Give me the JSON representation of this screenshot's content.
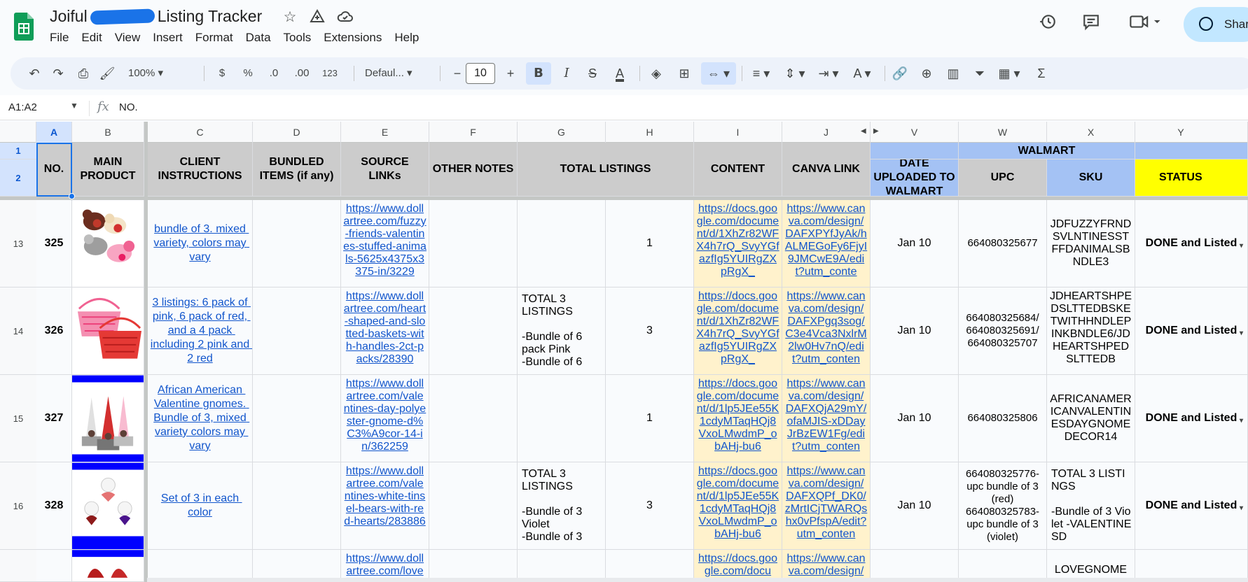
{
  "title": {
    "before": "Joiful",
    "after": "Listing Tracker"
  },
  "menu": [
    "File",
    "Edit",
    "View",
    "Insert",
    "Format",
    "Data",
    "Tools",
    "Extensions",
    "Help"
  ],
  "share_label": "Shar",
  "toolbar": {
    "zoom": "100%",
    "currency": "$",
    "percent": "%",
    "dec_minus": ".0",
    "dec_plus": ".00",
    "format_123": "123",
    "font": "Defaul...",
    "font_size": "10"
  },
  "formula_bar": {
    "name_box": "A1:A2",
    "value": "NO."
  },
  "columns": [
    "A",
    "B",
    "C",
    "D",
    "E",
    "F",
    "G",
    "H",
    "I",
    "J",
    "V",
    "W",
    "X",
    "Y"
  ],
  "row_numbers": [
    "1",
    "2",
    "13",
    "14",
    "15",
    "16"
  ],
  "headers": {
    "no": "NO.",
    "main_product": "MAIN PRODUCT",
    "client_instructions": "CLIENT INSTRUCTIONS",
    "bundled_items": "BUNDLED ITEMS (if any)",
    "source_links": "SOURCE LINKs",
    "other_notes": "OTHER NOTES",
    "total_listings": "TOTAL LISTINGS",
    "content": "CONTENT",
    "canva_link": "CANVA LINK",
    "walmart_group": "WALMART",
    "date_uploaded": "DATE UPLOADED TO WALMART",
    "upc": "UPC",
    "sku": "SKU",
    "status": "STATUS"
  },
  "rows": [
    {
      "no": "325",
      "instructions": "bundle of 3. mixed variety, colors may vary",
      "source": "https://www.dollartree.com/fuzzy-friends-valentines-stuffed-animals-5625x4375x3375-in/3229",
      "total_notes": "",
      "total": "1",
      "content": "https://docs.google.com/document/d/1XhZr82WFX4h7rQ_SvyYGfazfIg5YUIRgZXpRgX_",
      "canva": "https://www.canva.com/design/DAFXPYfJyAk/hALMEGoFy6FjyI9JMCwE9A/edit?utm_conte",
      "date": "Jan 10",
      "upc": "664080325677",
      "sku": "JDFUZZYFRNDSVLNTINESSTFFDANIMALSBNDLE3",
      "status": "DONE and Listed"
    },
    {
      "no": "326",
      "instructions": "3 listings: 6 pack of pink, 6 pack of red, and a 4 pack including 2 pink and 2 red",
      "source": "https://www.dollartree.com/heart-shaped-and-slotted-baskets-with-handles-2ct-packs/28390",
      "total_notes": "TOTAL 3 LISTINGS\n\n-Bundle of 6 pack Pink\n-Bundle of 6",
      "total": "3",
      "content": "https://docs.google.com/document/d/1XhZr82WFX4h7rQ_SvyYGfazfIg5YUIRgZXpRgX_",
      "canva": "https://www.canva.com/design/DAFXPgq3sog/C3e4Vca3NxlrM2lw0Hv7nQ/edit?utm_conten",
      "date": "Jan 10",
      "upc": "664080325684/\n664080325691/\n664080325707",
      "sku": "JDHEARTSHPEDSLTTEDBSKETWITHHNDLEPINKBNDLE6/JDHEARTSHPEDSLTTEDB",
      "status": "DONE and Listed"
    },
    {
      "no": "327",
      "instructions": "African American Valentine gnomes. Bundle of 3, mixed variety colors may vary",
      "source": "https://www.dollartree.com/valentines-day-polyester-gnome-d%C3%A9cor-14-in/362259",
      "total_notes": "",
      "total": "1",
      "content": "https://docs.google.com/document/d/1lp5JEe55K1cdyMTaqHQj8VxoLMwdmP_obAHj-bu6",
      "canva": "https://www.canva.com/design/DAFXQjA29mY/ofaMJIS-xDDayJrBzEW1Fg/edit?utm_conten",
      "date": "Jan 10",
      "upc": "664080325806",
      "sku": "AFRICANAMERICANVALENTINESDAYGNOMEDECOR14",
      "status": "DONE and Listed"
    },
    {
      "no": "328",
      "instructions": "Set of 3 in each color",
      "source": "https://www.dollartree.com/valentines-white-tinsel-bears-with-red-hearts/283886",
      "total_notes": "TOTAL 3 LISTINGS\n\n-Bundle of 3 Violet\n-Bundle of 3",
      "total": "3",
      "content": "https://docs.google.com/document/d/1lp5JEe55K1cdyMTaqHQj8VxoLMwdmP_obAHj-bu6",
      "canva": "https://www.canva.com/design/DAFXQPf_DK0/zMrtICjTWARQshx0vPfspA/edit?utm_conten",
      "date": "Jan 10",
      "upc": "664080325776-upc bundle of 3 (red)\n664080325783-upc bundle of 3 (violet)",
      "sku": "TOTAL 3 LISTINGS\n\n-Bundle of 3 Violet -VALENTINESD",
      "status": "DONE and Listed"
    },
    {
      "no": "",
      "instructions": "",
      "source": "https://www.dollartree.com/love",
      "total_notes": "",
      "total": "",
      "content": "https://docs.google.com/docu",
      "canva": "https://www.canva.com/design/",
      "date": "",
      "upc": "",
      "sku": "LOVEGNOME",
      "status": ""
    }
  ],
  "colors": {
    "header_gray": "#cccccc",
    "walmart_blue": "#a4c2f4",
    "status_yellow": "#ffff00",
    "link_blue": "#1155cc",
    "cream": "#fff2cc",
    "sheets_green": "#0f9d58"
  }
}
